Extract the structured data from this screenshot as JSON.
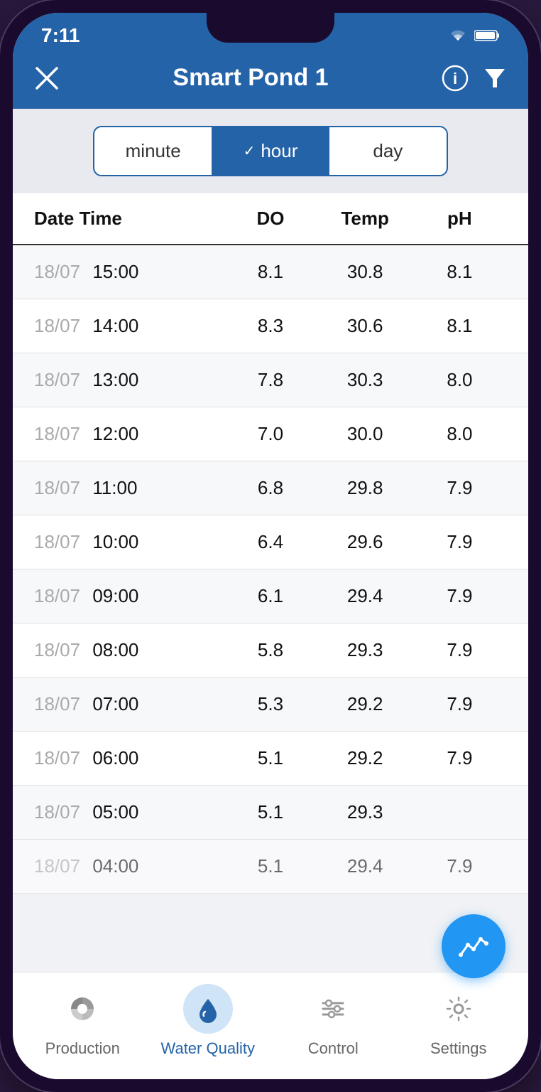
{
  "statusBar": {
    "time": "7:11"
  },
  "header": {
    "title": "Smart Pond 1",
    "closeLabel": "×",
    "infoLabel": "ℹ",
    "filterLabel": "▼"
  },
  "segmentControl": {
    "options": [
      {
        "id": "minute",
        "label": "minute",
        "active": false
      },
      {
        "id": "hour",
        "label": "hour",
        "active": true
      },
      {
        "id": "day",
        "label": "day",
        "active": false
      }
    ]
  },
  "table": {
    "headers": [
      "Date Time",
      "DO",
      "Temp",
      "pH"
    ],
    "rows": [
      {
        "date": "18/07",
        "time": "15:00",
        "do": "8.1",
        "temp": "30.8",
        "ph": "8.1"
      },
      {
        "date": "18/07",
        "time": "14:00",
        "do": "8.3",
        "temp": "30.6",
        "ph": "8.1"
      },
      {
        "date": "18/07",
        "time": "13:00",
        "do": "7.8",
        "temp": "30.3",
        "ph": "8.0"
      },
      {
        "date": "18/07",
        "time": "12:00",
        "do": "7.0",
        "temp": "30.0",
        "ph": "8.0"
      },
      {
        "date": "18/07",
        "time": "11:00",
        "do": "6.8",
        "temp": "29.8",
        "ph": "7.9"
      },
      {
        "date": "18/07",
        "time": "10:00",
        "do": "6.4",
        "temp": "29.6",
        "ph": "7.9"
      },
      {
        "date": "18/07",
        "time": "09:00",
        "do": "6.1",
        "temp": "29.4",
        "ph": "7.9"
      },
      {
        "date": "18/07",
        "time": "08:00",
        "do": "5.8",
        "temp": "29.3",
        "ph": "7.9"
      },
      {
        "date": "18/07",
        "time": "07:00",
        "do": "5.3",
        "temp": "29.2",
        "ph": "7.9"
      },
      {
        "date": "18/07",
        "time": "06:00",
        "do": "5.1",
        "temp": "29.2",
        "ph": "7.9"
      },
      {
        "date": "18/07",
        "time": "05:00",
        "do": "5.1",
        "temp": "29.3",
        "ph": ""
      },
      {
        "date": "18/07",
        "time": "04:00",
        "do": "5.1",
        "temp": "29.4",
        "ph": "7.9"
      }
    ]
  },
  "bottomNav": [
    {
      "id": "production",
      "label": "Production",
      "active": false
    },
    {
      "id": "waterquality",
      "label": "Water Quality",
      "active": true
    },
    {
      "id": "control",
      "label": "Control",
      "active": false
    },
    {
      "id": "settings",
      "label": "Settings",
      "active": false
    }
  ]
}
